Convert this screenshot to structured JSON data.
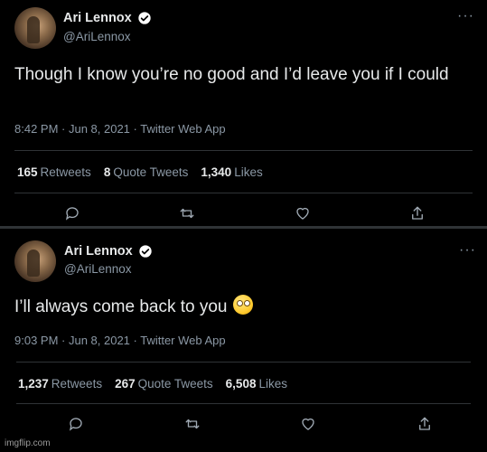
{
  "tweets": [
    {
      "display_name": "Ari Lennox",
      "handle": "@AriLennox",
      "text": "Though I know you’re no good and I’d leave you if I could",
      "meta": "8:42 PM · Jun 8, 2021 · Twitter Web App",
      "retweets": "165",
      "retweets_label": "Retweets",
      "quotes": "8",
      "quotes_label": "Quote Tweets",
      "likes": "1,340",
      "likes_label": "Likes"
    },
    {
      "display_name": "Ari Lennox",
      "handle": "@AriLennox",
      "text": "I’ll always come back to you",
      "emoji": "face-with-rolling-eyes",
      "meta": "9:03 PM · Jun 8, 2021 · Twitter Web App",
      "retweets": "1,237",
      "retweets_label": "Retweets",
      "quotes": "267",
      "quotes_label": "Quote Tweets",
      "likes": "6,508",
      "likes_label": "Likes"
    }
  ],
  "icons": {
    "verified": "verified-badge-icon",
    "more": "more-options-icon",
    "reply": "reply-icon",
    "retweet": "retweet-icon",
    "like": "heart-icon",
    "share": "share-icon"
  },
  "colors": {
    "background": "#000000",
    "text": "#e7e9ea",
    "secondary": "#8b98a5",
    "border": "#2f3336"
  },
  "watermark": "imgflip.com"
}
